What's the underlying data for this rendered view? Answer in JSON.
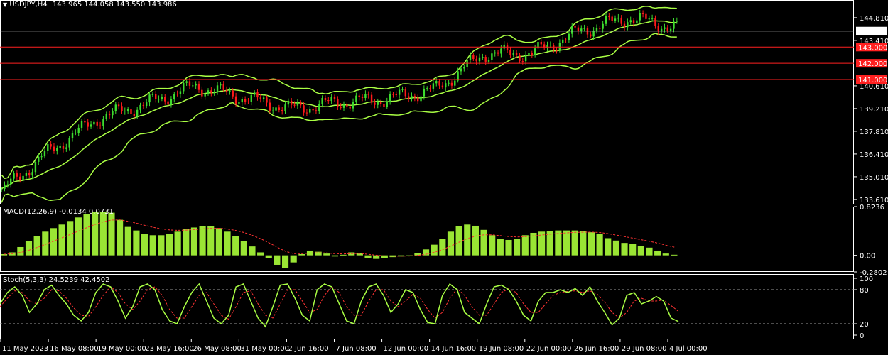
{
  "colors": {
    "background": "#000000",
    "bull": "#3ddc2e",
    "bear": "#ff1a1a",
    "band": "#aaff44",
    "macd_hist": "#9ae534",
    "signal": "#ff3333",
    "stoch": "#aaff44",
    "level": "#ff2020",
    "price_line": "#c0c0c0",
    "axis": "#ffffff"
  },
  "header": {
    "symbol": "USDJPY,H4",
    "ohlc": "143.965 144.058 143.550 143.986"
  },
  "price_axis": {
    "ticks": [
      "144.810",
      "143.410",
      "140.610",
      "139.210",
      "137.810",
      "136.410",
      "135.010",
      "133.610"
    ],
    "current_price": "143.986",
    "levels": [
      "143.000",
      "142.000",
      "141.000"
    ]
  },
  "macd": {
    "label": "MACD(12,26,9) -0.0134 0.0731",
    "ticks": [
      "0.8236",
      "0.00",
      "-0.2802"
    ]
  },
  "stoch": {
    "label": "Stoch(5,3,3) 24.5239 42.4502",
    "ticks": [
      "100",
      "80",
      "20",
      "0"
    ]
  },
  "time_axis": [
    "11 May 2023",
    "16 May 08:00",
    "19 May 00:00",
    "23 May 16:00",
    "26 May 08:00",
    "31 May 00:00",
    "2 Jun 16:00",
    "7 Jun 08:00",
    "12 Jun 00:00",
    "14 Jun 16:00",
    "19 Jun 08:00",
    "22 Jun 00:00",
    "26 Jun 16:00",
    "29 Jun 08:00",
    "4 Jul 00:00"
  ],
  "chart_data": [
    {
      "type": "line",
      "title": "USDJPY,H4",
      "ylim": [
        133.3,
        145.9
      ],
      "x": [
        "11 May 2023",
        "16 May 08:00",
        "19 May 00:00",
        "23 May 16:00",
        "26 May 08:00",
        "31 May 00:00",
        "2 Jun 16:00",
        "7 Jun 08:00",
        "12 Jun 00:00",
        "14 Jun 16:00",
        "19 Jun 08:00",
        "22 Jun 00:00",
        "26 Jun 16:00",
        "29 Jun 08:00",
        "4 Jul 00:00"
      ],
      "series": [
        {
          "name": "",
          "values": [
            134.1,
            136.6,
            138.6,
            139.5,
            140.6,
            139.9,
            139.2,
            139.6,
            139.8,
            140.4,
            142.6,
            142.6,
            144.0,
            144.8,
            144.2
          ]
        }
      ],
      "horizontal_lines": [
        143.0,
        142.0,
        141.0
      ],
      "last_price": 143.986
    },
    {
      "type": "bar",
      "title": "MACD(12,26,9) -0.0134 0.0731",
      "ylim": [
        -0.2802,
        0.8236
      ],
      "values": [
        0.02,
        0.05,
        0.14,
        0.24,
        0.32,
        0.4,
        0.46,
        0.52,
        0.58,
        0.64,
        0.7,
        0.74,
        0.74,
        0.72,
        0.6,
        0.48,
        0.42,
        0.36,
        0.34,
        0.34,
        0.36,
        0.4,
        0.44,
        0.47,
        0.49,
        0.49,
        0.46,
        0.4,
        0.32,
        0.24,
        0.15,
        0.05,
        -0.05,
        -0.16,
        -0.22,
        -0.12,
        0.02,
        0.08,
        0.06,
        0.03,
        -0.02,
        0.01,
        0.05,
        0.04,
        -0.04,
        -0.06,
        -0.05,
        -0.03,
        -0.02,
        0.0,
        0.04,
        0.1,
        0.18,
        0.28,
        0.4,
        0.49,
        0.52,
        0.5,
        0.43,
        0.34,
        0.28,
        0.26,
        0.28,
        0.34,
        0.38,
        0.4,
        0.41,
        0.42,
        0.42,
        0.42,
        0.41,
        0.39,
        0.36,
        0.29,
        0.25,
        0.21,
        0.19,
        0.16,
        0.13,
        0.08,
        0.03,
        0.01
      ],
      "ticks": [
        "0.8236",
        "0.00",
        "-0.2802"
      ]
    },
    {
      "type": "line",
      "title": "Stoch(5,3,3) 24.5239 42.4502",
      "ylim": [
        0,
        100
      ],
      "values": [
        55,
        75,
        85,
        70,
        40,
        55,
        80,
        88,
        70,
        55,
        35,
        25,
        40,
        75,
        90,
        85,
        60,
        30,
        50,
        85,
        90,
        80,
        45,
        25,
        20,
        50,
        75,
        90,
        60,
        30,
        20,
        35,
        85,
        90,
        60,
        30,
        15,
        50,
        88,
        90,
        65,
        35,
        25,
        80,
        90,
        85,
        55,
        25,
        20,
        60,
        85,
        90,
        70,
        40,
        55,
        80,
        75,
        45,
        22,
        20,
        70,
        90,
        80,
        40,
        30,
        20,
        55,
        85,
        88,
        80,
        60,
        35,
        25,
        60,
        75,
        75,
        80,
        75,
        82,
        70,
        85,
        60,
        40,
        18,
        30,
        70,
        75,
        55,
        60,
        68,
        60,
        30,
        24
      ],
      "signal": [
        50,
        65,
        78,
        75,
        60,
        55,
        65,
        80,
        78,
        65,
        48,
        35,
        33,
        50,
        70,
        85,
        75,
        55,
        45,
        60,
        80,
        85,
        70,
        45,
        30,
        30,
        50,
        70,
        75,
        55,
        35,
        28,
        50,
        75,
        78,
        55,
        35,
        30,
        55,
        80,
        80,
        60,
        40,
        45,
        70,
        85,
        75,
        50,
        35,
        35,
        60,
        80,
        80,
        60,
        50,
        60,
        72,
        65,
        45,
        30,
        40,
        65,
        82,
        70,
        50,
        35,
        35,
        55,
        75,
        82,
        75,
        55,
        40,
        40,
        55,
        70,
        75,
        77,
        78,
        75,
        78,
        72,
        58,
        40,
        30,
        40,
        60,
        65,
        60,
        60,
        62,
        52,
        42
      ],
      "ticks": [
        "100",
        "80",
        "20",
        "0"
      ],
      "levels": [
        80,
        20
      ]
    }
  ]
}
